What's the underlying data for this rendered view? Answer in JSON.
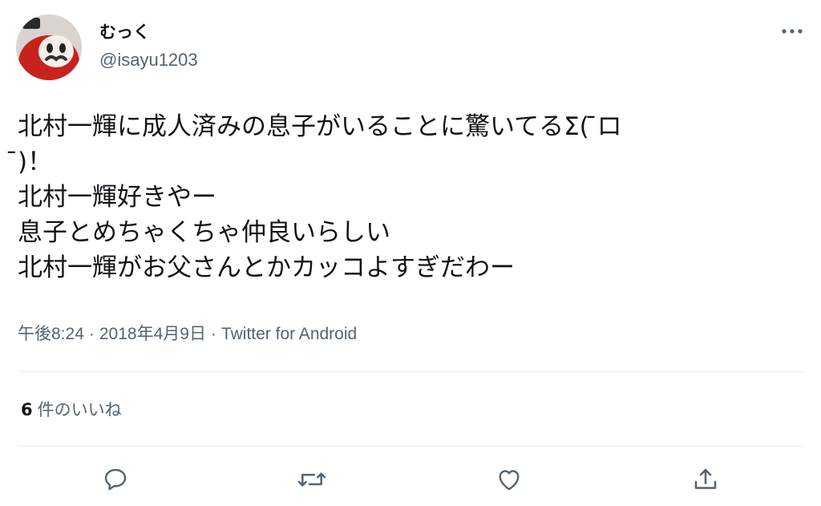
{
  "user": {
    "display_name": "むっく",
    "handle": "@isayu1203",
    "avatar": "daruma-avatar"
  },
  "tweet": {
    "lines": [
      "北村一輝に成人済みの息子がいることに驚いてるΣ( ̄ロ",
      " ̄)！",
      "北村一輝好きやー",
      "息子とめちゃくちゃ仲良いらしい",
      "北村一輝がお父さんとかカッコよすぎだわー"
    ],
    "time": "午後8:24",
    "date": "2018年4月9日",
    "source": "Twitter for Android",
    "separator": "·"
  },
  "likes": {
    "count": "6",
    "label": "件のいいね"
  },
  "actions": {
    "reply": "reply-icon",
    "retweet": "retweet-icon",
    "like": "heart-icon",
    "share": "share-icon",
    "more": "more-icon"
  },
  "colors": {
    "text": "#0f1419",
    "secondary": "#536471",
    "divider": "#e6ecf0",
    "avatar_red": "#c8221f"
  }
}
